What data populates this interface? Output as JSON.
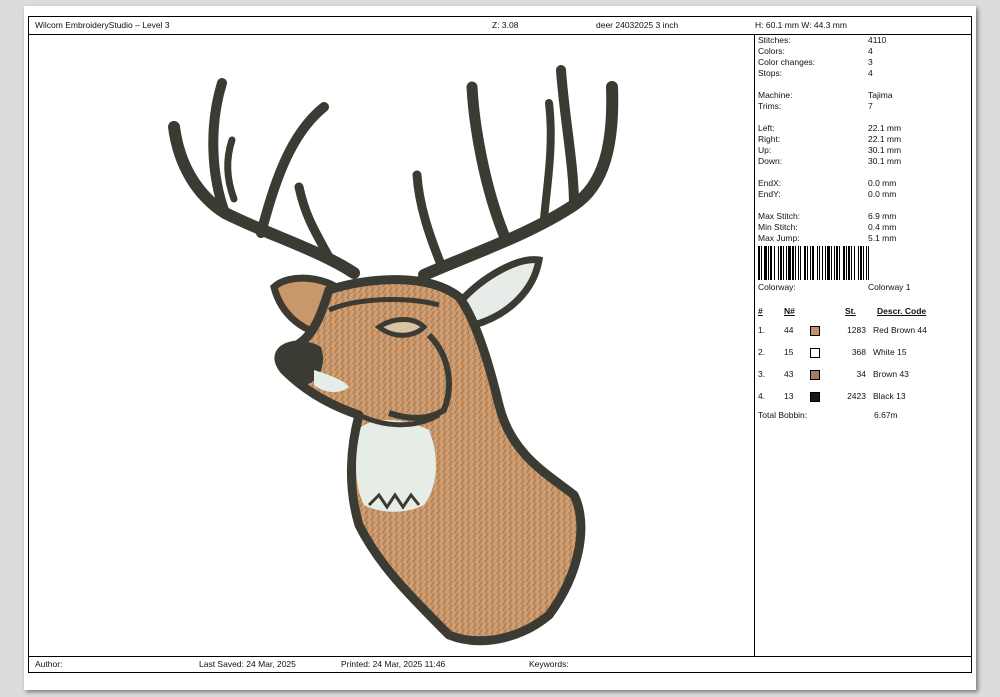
{
  "header": {
    "title": "Wilcom EmbroideryStudio – Level 3",
    "zoom": "Z: 3.08",
    "filename": "deer 24032025 3 inch",
    "dimensions": "H: 60.1 mm   W: 44.3 mm"
  },
  "stats": [
    {
      "label": "Stitches:",
      "value": "4110"
    },
    {
      "label": "Colors:",
      "value": "4"
    },
    {
      "label": "Color changes:",
      "value": "3"
    },
    {
      "label": "Stops:",
      "value": "4"
    },
    {
      "gap": true
    },
    {
      "label": "Machine:",
      "value": "Tajima"
    },
    {
      "label": "Trims:",
      "value": "7"
    },
    {
      "gap": true
    },
    {
      "label": "Left:",
      "value": "22.1 mm"
    },
    {
      "label": "Right:",
      "value": "22.1 mm"
    },
    {
      "label": "Up:",
      "value": "30.1 mm"
    },
    {
      "label": "Down:",
      "value": "30.1 mm"
    },
    {
      "gap": true
    },
    {
      "label": "EndX:",
      "value": "0.0 mm"
    },
    {
      "label": "EndY:",
      "value": "0.0 mm"
    },
    {
      "gap": true
    },
    {
      "label": "Max Stitch:",
      "value": "6.9 mm"
    },
    {
      "label": "Min Stitch:",
      "value": "0.4 mm"
    },
    {
      "label": "Max Jump:",
      "value": "5.1 mm"
    }
  ],
  "colorway": {
    "label": "Colorway:",
    "value": "Colorway 1"
  },
  "table": {
    "headers": {
      "num": "#",
      "n": "N#",
      "st": "St.",
      "descr": "Descr. Code"
    },
    "rows": [
      {
        "idx": "1.",
        "n": "44",
        "st": "1283",
        "descr": "Red Brown 44",
        "color": "#c8916a"
      },
      {
        "idx": "2.",
        "n": "15",
        "st": "368",
        "descr": "White 15",
        "color": "#ffffff"
      },
      {
        "idx": "3.",
        "n": "43",
        "st": "34",
        "descr": "Brown 43",
        "color": "#a07d63"
      },
      {
        "idx": "4.",
        "n": "13",
        "st": "2423",
        "descr": "Black 13",
        "color": "#1a1a1a"
      }
    ]
  },
  "bobbin": {
    "label": "Total Bobbin:",
    "value": "6.67m"
  },
  "footer": {
    "author": "Author:",
    "last_saved": "Last Saved: 24 Mar, 2025",
    "printed": "Printed: 24 Mar, 2025 11:46",
    "keywords": "Keywords:"
  },
  "design": {
    "icon": "deer-head-embroidery",
    "outline_color": "#3b3b33",
    "fill_color": "#c8976a",
    "bib_color": "#e6ece6"
  }
}
